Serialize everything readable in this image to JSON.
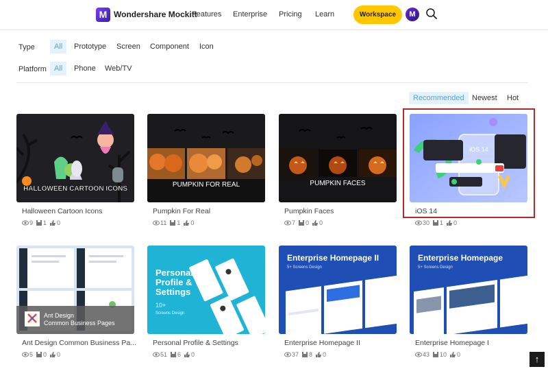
{
  "header": {
    "logo_letter": "M",
    "brand": "Wondershare Mockitt",
    "nav": [
      "Features",
      "Enterprise",
      "Pricing",
      "Learn"
    ],
    "workspace": "Workspace",
    "avatar_letter": "M"
  },
  "filters": {
    "type_label": "Type",
    "type_options": [
      "All",
      "Prototype",
      "Screen",
      "Component",
      "Icon"
    ],
    "platform_label": "Platform",
    "platform_options": [
      "All",
      "Phone",
      "Web/TV"
    ]
  },
  "sort": [
    "Recommended",
    "Newest",
    "Hot"
  ],
  "cards": [
    {
      "title": "Halloween Cartoon Icons",
      "overlay": "HALLOWEEN CARTOON ICONS",
      "views": "9",
      "saves": "1",
      "likes": "0"
    },
    {
      "title": "Pumpkin For Real",
      "overlay": "PUMPKIN FOR REAL",
      "views": "11",
      "saves": "1",
      "likes": "0"
    },
    {
      "title": "Pumpkin Faces",
      "overlay": "PUMPKIN FACES",
      "views": "7",
      "saves": "0",
      "likes": "0"
    },
    {
      "title": "iOS 14",
      "overlay": "iOS 14",
      "views": "30",
      "saves": "1",
      "likes": "0"
    },
    {
      "title": "Ant Design Common Business Pa...",
      "overlay_line1": "Ant Design",
      "overlay_line2": "Common Business Pages",
      "views": "5",
      "saves": "0",
      "likes": "0"
    },
    {
      "title": "Personal Profile & Settings",
      "overlay_line1": "Personal",
      "overlay_line2": "Profile &",
      "overlay_line3": "Settings",
      "overlay_sub": "10+",
      "overlay_sub2": "Screens Design",
      "views": "51",
      "saves": "6",
      "likes": "0"
    },
    {
      "title": "Enterprise Homepage II",
      "overlay": "Enterprise Homepage II",
      "overlay_sub": "5+ Screens Design",
      "views": "37",
      "saves": "8",
      "likes": "0"
    },
    {
      "title": "Enterprise Homepage I",
      "overlay": "Enterprise Homepage",
      "overlay_sub": "5+ Screens Design",
      "views": "43",
      "saves": "10",
      "likes": "0"
    }
  ],
  "colors": {
    "accent": "#ffc700",
    "active_chip_bg": "#e5f2fb",
    "active_chip_text": "#5aa3d8",
    "highlight": "#b8282b"
  },
  "back_to_top": "↑"
}
